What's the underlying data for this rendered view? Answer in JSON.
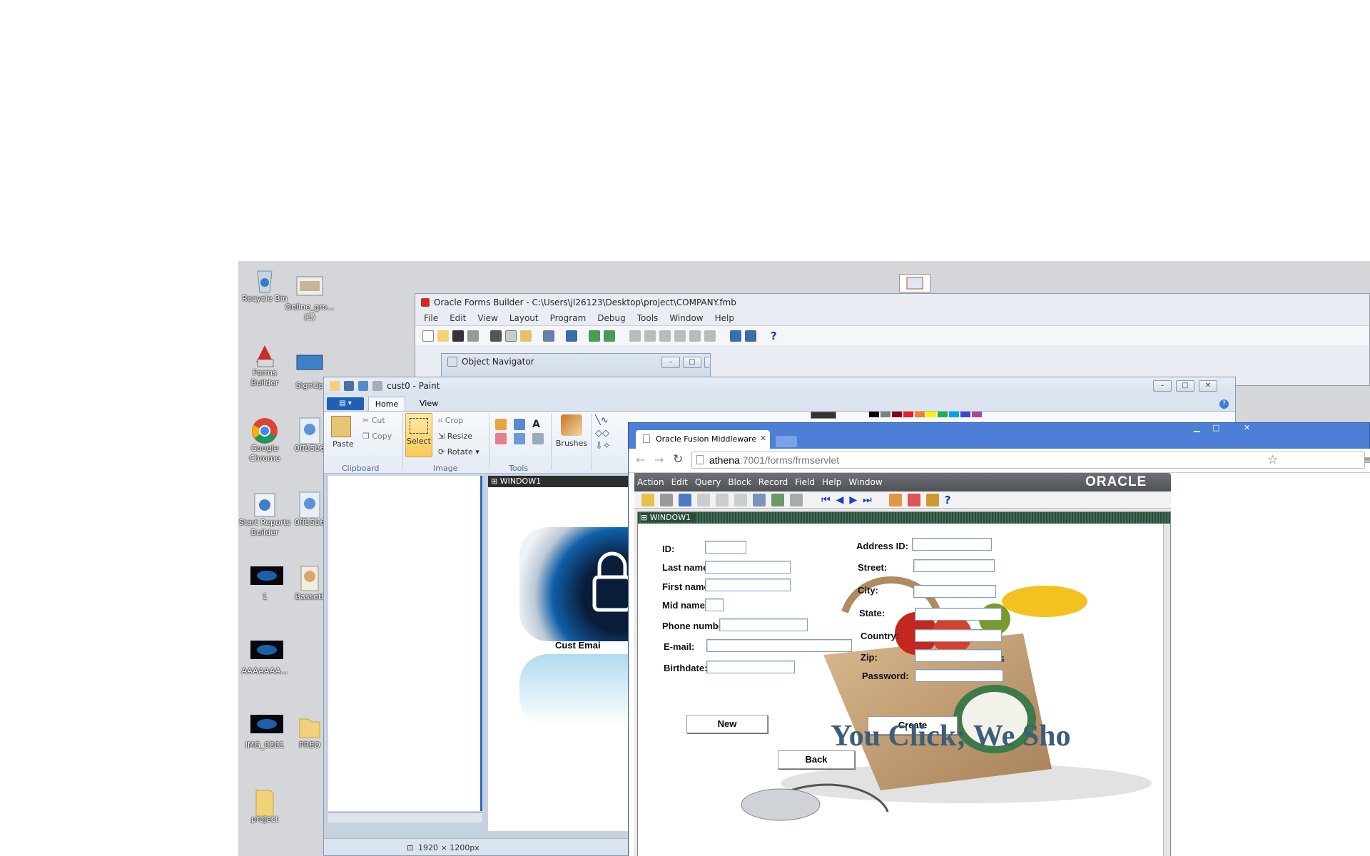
{
  "desktop": {
    "icons": [
      {
        "label": "Recycle Bin",
        "icon": "recycle-bin-icon"
      },
      {
        "label": "Online_gro...\n(1)",
        "icon": "image-file-icon"
      },
      {
        "label": "Forms\nBuilder",
        "icon": "forms-builder-icon"
      },
      {
        "label": "SignUp",
        "icon": "image-file-icon"
      },
      {
        "label": "Google\nChrome",
        "icon": "chrome-icon"
      },
      {
        "label": "0ffb5b6",
        "icon": "image-file-icon"
      },
      {
        "label": "Start Reports\nBuilder",
        "icon": "reports-builder-icon"
      },
      {
        "label": "0ffb5b6",
        "icon": "image-file-icon"
      },
      {
        "label": "1",
        "icon": "image-file-icon"
      },
      {
        "label": "Bassett",
        "icon": "image-file-icon"
      },
      {
        "label": "AAAAAAA...",
        "icon": "image-file-icon"
      },
      {
        "label": "IMG_0201",
        "icon": "image-file-icon"
      },
      {
        "label": "PREO",
        "icon": "folder-icon"
      },
      {
        "label": "project",
        "icon": "folder-icon"
      }
    ]
  },
  "forms_builder": {
    "title": "Oracle Forms Builder - C:\\Users\\jl26123\\Desktop\\project\\COMPANY.fmb",
    "menu": [
      "File",
      "Edit",
      "View",
      "Layout",
      "Program",
      "Debug",
      "Tools",
      "Window",
      "Help"
    ],
    "object_navigator_title": "Object Navigator"
  },
  "paint": {
    "title": "cust0 - Paint",
    "tabs": [
      "Home",
      "View"
    ],
    "clipboard": {
      "paste": "Paste",
      "cut": "Cut",
      "copy": "Copy",
      "group": "Clipboard"
    },
    "image": {
      "select": "Select",
      "crop": "Crop",
      "resize": "Resize",
      "rotate": "Rotate",
      "group": "Image"
    },
    "tools_group": "Tools",
    "brushes": "Brushes",
    "canvas_window_label": "WINDOW1",
    "canvas_text": "Cust Emai",
    "status_size": "1920 × 1200px"
  },
  "browser": {
    "tab_title": "Oracle Fusion Middleware",
    "url_host": "athena",
    "url_rest": ":7001/forms/frmservlet"
  },
  "oracle_form": {
    "menu": [
      "Action",
      "Edit",
      "Query",
      "Block",
      "Record",
      "Field",
      "Help",
      "Window"
    ],
    "brand": "ORACLE",
    "window_label": "WINDOW1",
    "left_fields": [
      {
        "label": "ID:",
        "value": ""
      },
      {
        "label": "Last name:",
        "value": ""
      },
      {
        "label": "First name:",
        "value": ""
      },
      {
        "label": "Mid name:",
        "value": ""
      },
      {
        "label": "Phone number",
        "value": ""
      },
      {
        "label": "E-mail:",
        "value": ""
      },
      {
        "label": "Birthdate:",
        "value": ""
      }
    ],
    "right_fields": [
      {
        "label": "Address ID:",
        "value": ""
      },
      {
        "label": "Street:",
        "value": ""
      },
      {
        "label": "City:",
        "value": ""
      },
      {
        "label": "State:",
        "value": ""
      },
      {
        "label": "Country:",
        "value": ""
      },
      {
        "label": "Zip:",
        "value": ""
      },
      {
        "label": "Password:",
        "value": ""
      }
    ],
    "buttons": {
      "new": "New",
      "create": "Create",
      "back": "Back"
    },
    "slogan": "You Click; We Sho",
    "logo_text": "BASSETT'S"
  },
  "colors": {
    "desktop_bg": "#d4d6d9",
    "chrome_frame": "#4e7fd6",
    "oracle_dark": "#5f6266",
    "slogan": "#3b5e7a"
  }
}
